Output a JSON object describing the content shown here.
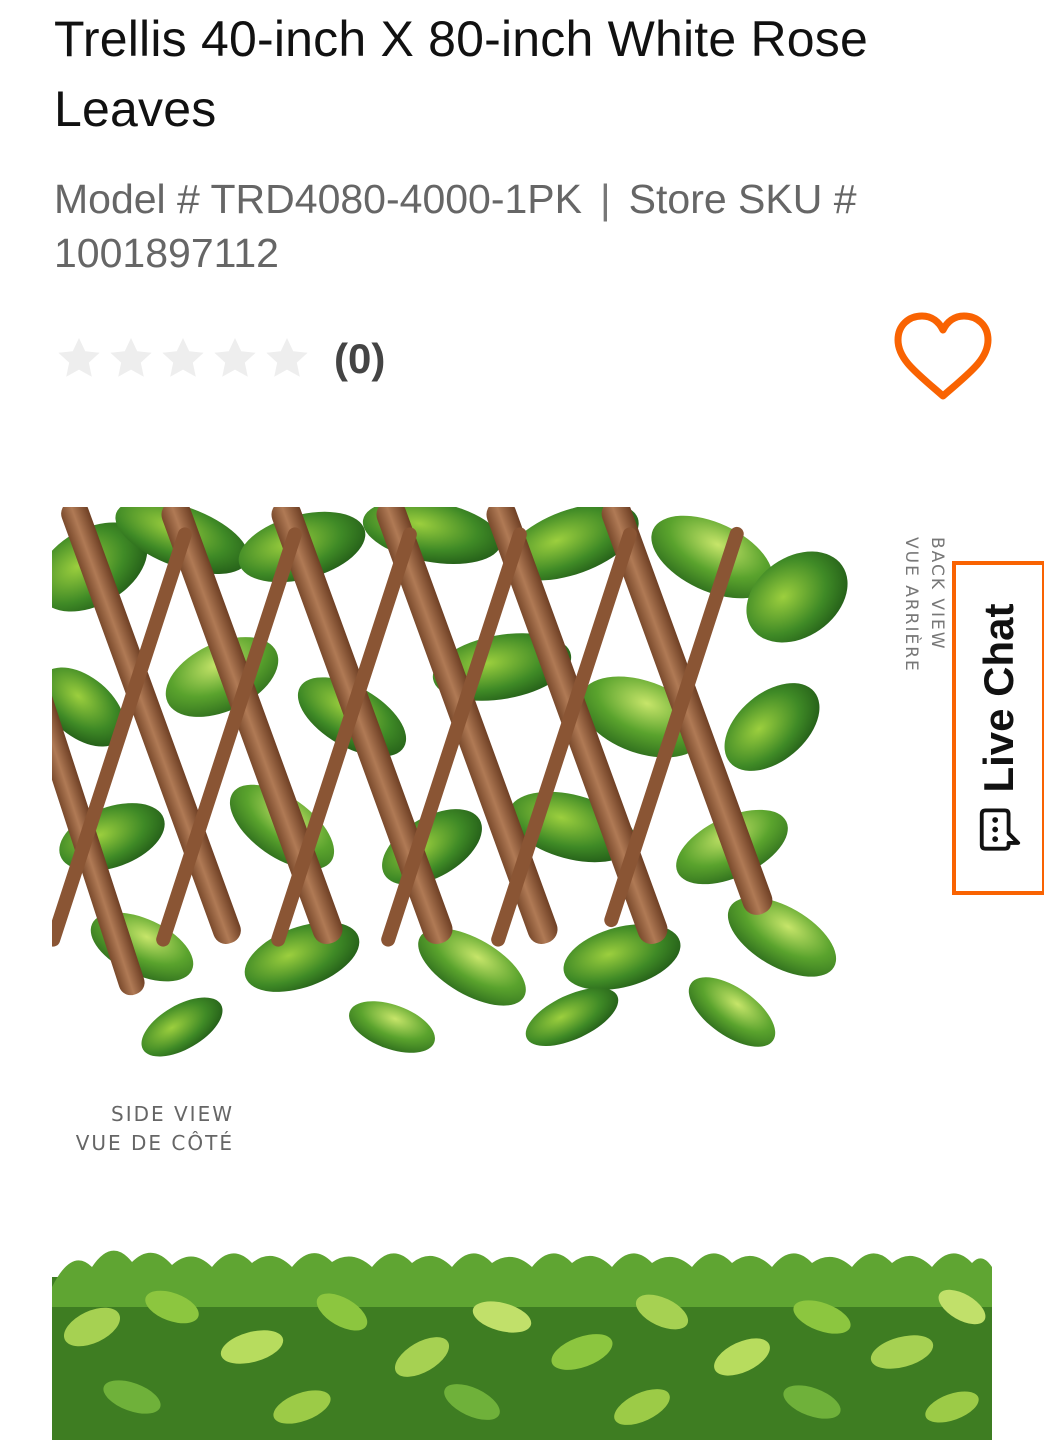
{
  "product": {
    "title": "Trellis 40-inch X 80-inch White Rose Leaves",
    "model_label": "Model # TRD4080-4000-1PK",
    "separator": "|",
    "sku_label": "Store SKU #",
    "sku_value": "1001897112",
    "rating_stars": 0,
    "rating_max": 5,
    "review_count": "(0)"
  },
  "gallery": {
    "back_view_en": "BACK VIEW",
    "back_view_fr": "VUE ARRIÈRE",
    "side_view_en": "SIDE VIEW",
    "side_view_fr": "VUE DE CÔTÉ"
  },
  "live_chat": {
    "label": "Live Chat"
  },
  "icons": {
    "favorite": "heart-icon",
    "chat": "chat-bubble-icon",
    "star": "star-icon"
  },
  "colors": {
    "accent": "#f96302",
    "star_empty": "#eeeeee",
    "title_text": "#111111",
    "secondary_text": "#666666"
  }
}
